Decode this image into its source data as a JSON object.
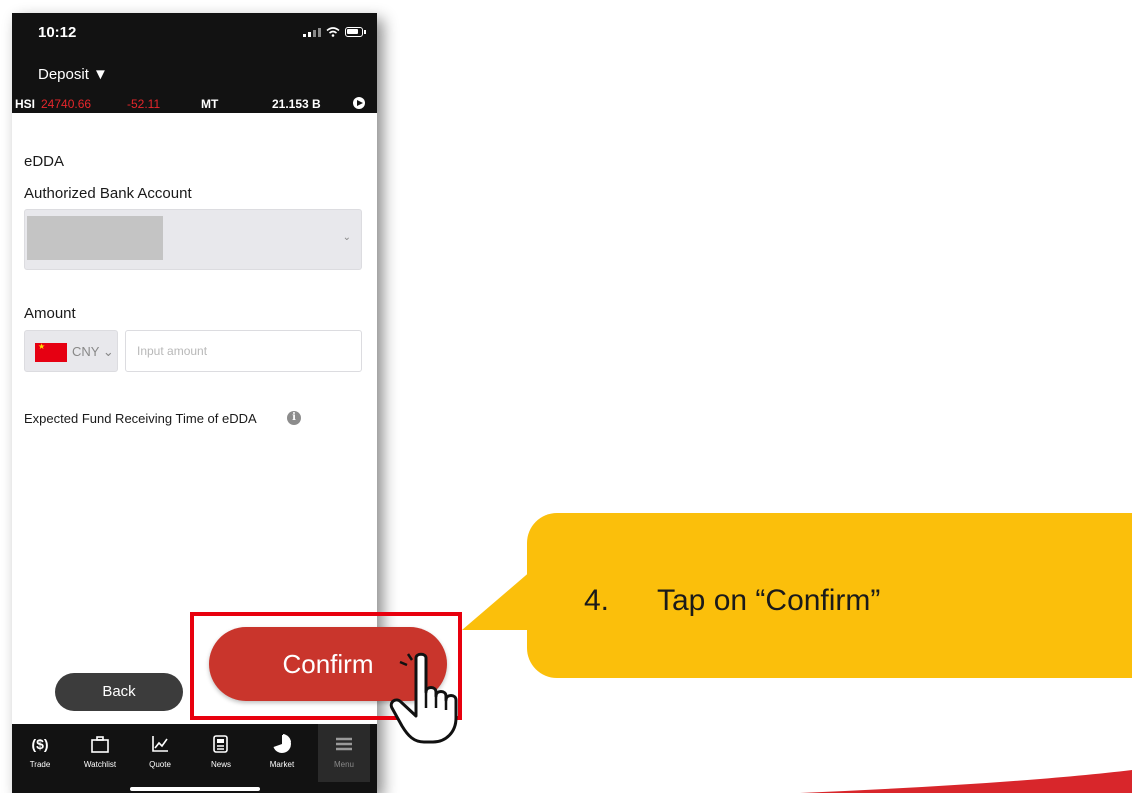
{
  "status_bar": {
    "time": "10:12"
  },
  "header": {
    "title": "Deposit ▼"
  },
  "ticker": {
    "index": "HSI",
    "value": "24740.66",
    "change": "-52.11",
    "label": "MT",
    "turnover": "21.153 B",
    "value_color": "#e6262b"
  },
  "form": {
    "section_title": "eDDA",
    "bank_account_label": "Authorized Bank Account",
    "amount_label": "Amount",
    "currency": "CNY",
    "amount_placeholder": "Input amount",
    "expected_time_label": "Expected Fund Receiving Time of eDDA"
  },
  "buttons": {
    "back": "Back",
    "confirm": "Confirm"
  },
  "tabs": [
    {
      "label": "Trade",
      "icon": "dollar-icon"
    },
    {
      "label": "Watchlist",
      "icon": "briefcase-icon"
    },
    {
      "label": "Quote",
      "icon": "chart-icon"
    },
    {
      "label": "News",
      "icon": "newspaper-icon"
    },
    {
      "label": "Market",
      "icon": "pie-icon"
    },
    {
      "label": "Menu",
      "icon": "menu-icon",
      "active": true
    }
  ],
  "callout": {
    "step": "4.",
    "text": "Tap on “Confirm”"
  },
  "colors": {
    "confirm_button": "#c9352c",
    "highlight_frame": "#e8000e",
    "callout_fill": "#fbbf0b"
  }
}
